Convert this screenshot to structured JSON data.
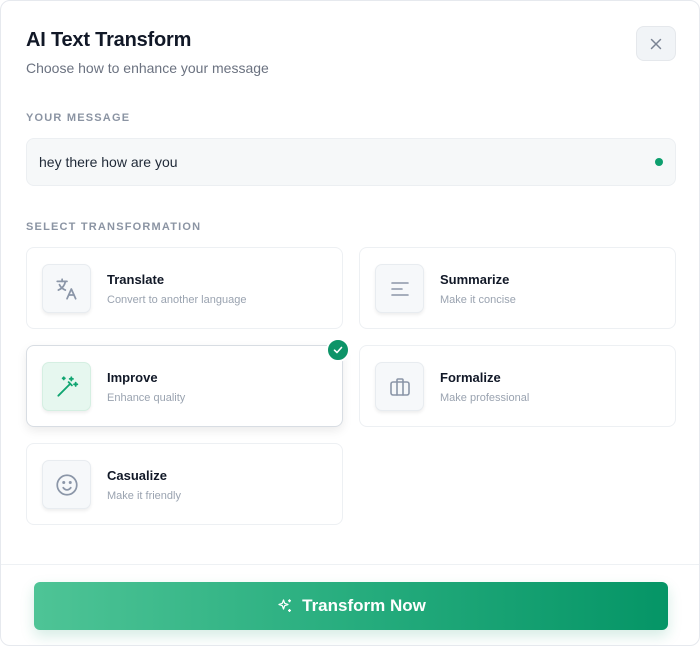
{
  "header": {
    "title": "AI Text Transform",
    "subtitle": "Choose how to enhance your message",
    "close_icon": "close-icon"
  },
  "message": {
    "label": "YOUR MESSAGE",
    "value": "hey there how are you",
    "status": "active"
  },
  "transformations": {
    "label": "SELECT TRANSFORMATION",
    "selected": "Improve",
    "items": [
      {
        "title": "Translate",
        "description": "Convert to another language",
        "icon": "translate-icon"
      },
      {
        "title": "Summarize",
        "description": "Make it concise",
        "icon": "align-left-icon"
      },
      {
        "title": "Improve",
        "description": "Enhance quality",
        "icon": "magic-wand-icon"
      },
      {
        "title": "Formalize",
        "description": "Make professional",
        "icon": "briefcase-icon"
      },
      {
        "title": "Casualize",
        "description": "Make it friendly",
        "icon": "smile-icon"
      }
    ]
  },
  "action": {
    "label": "Transform Now",
    "icon": "sparkles-icon"
  },
  "colors": {
    "accent": "#0d9468",
    "accent_light": "#e6f7ef",
    "icon_muted": "#8b96a8"
  }
}
